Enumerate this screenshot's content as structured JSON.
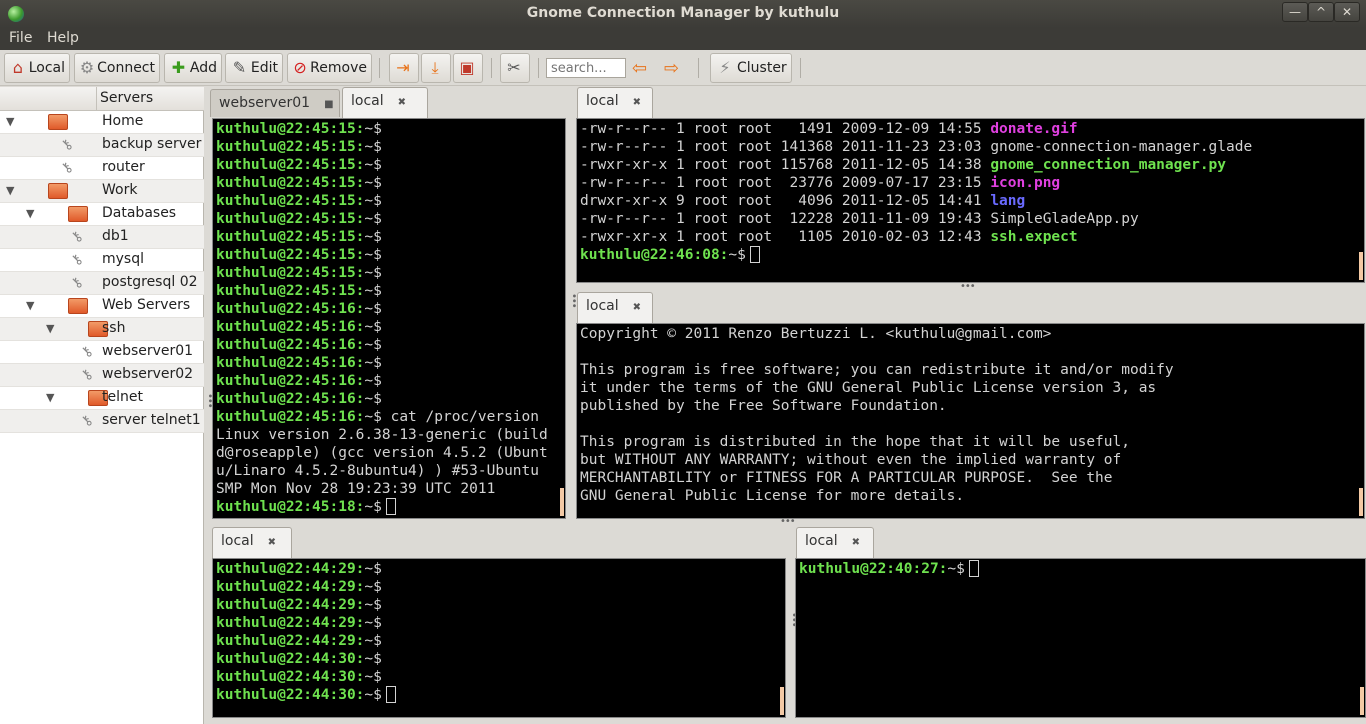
{
  "window": {
    "title": "Gnome Connection Manager by kuthulu"
  },
  "window_controls": {
    "minimize": "—",
    "maximize": "^",
    "close": "✕"
  },
  "menu": {
    "file": "File",
    "help": "Help"
  },
  "toolbar": {
    "local": "Local",
    "connect": "Connect",
    "add": "Add",
    "edit": "Edit",
    "remove": "Remove",
    "search_placeholder": "search...",
    "cluster": "Cluster"
  },
  "sidebar": {
    "header": "Servers",
    "items": [
      {
        "label": "Home",
        "type": "folder",
        "level": 0,
        "expanded": true
      },
      {
        "label": "backup server",
        "type": "host",
        "level": 1
      },
      {
        "label": "router",
        "type": "host",
        "level": 1
      },
      {
        "label": "Work",
        "type": "folder",
        "level": 0,
        "expanded": true
      },
      {
        "label": "Databases",
        "type": "folder",
        "level": 1,
        "expanded": true
      },
      {
        "label": "db1",
        "type": "host",
        "level": 2
      },
      {
        "label": "mysql",
        "type": "host",
        "level": 2
      },
      {
        "label": "postgresql 02",
        "type": "host",
        "level": 2
      },
      {
        "label": "Web Servers",
        "type": "folder",
        "level": 1,
        "expanded": true
      },
      {
        "label": "ssh",
        "type": "folder",
        "level": 2,
        "expanded": true
      },
      {
        "label": "webserver01",
        "type": "host",
        "level": 3
      },
      {
        "label": "webserver02",
        "type": "host",
        "level": 3
      },
      {
        "label": "telnet",
        "type": "folder",
        "level": 2,
        "expanded": true
      },
      {
        "label": "server telnet1",
        "type": "host",
        "level": 3
      }
    ]
  },
  "panel_top_left": {
    "tabs": [
      {
        "label": "webserver01",
        "active": false
      },
      {
        "label": "local",
        "active": true
      }
    ],
    "lines": [
      {
        "prompt": "kuthulu@22:45:15:",
        "rest": "~$"
      },
      {
        "prompt": "kuthulu@22:45:15:",
        "rest": "~$"
      },
      {
        "prompt": "kuthulu@22:45:15:",
        "rest": "~$"
      },
      {
        "prompt": "kuthulu@22:45:15:",
        "rest": "~$"
      },
      {
        "prompt": "kuthulu@22:45:15:",
        "rest": "~$"
      },
      {
        "prompt": "kuthulu@22:45:15:",
        "rest": "~$"
      },
      {
        "prompt": "kuthulu@22:45:15:",
        "rest": "~$"
      },
      {
        "prompt": "kuthulu@22:45:15:",
        "rest": "~$"
      },
      {
        "prompt": "kuthulu@22:45:15:",
        "rest": "~$"
      },
      {
        "prompt": "kuthulu@22:45:15:",
        "rest": "~$"
      },
      {
        "prompt": "kuthulu@22:45:16:",
        "rest": "~$"
      },
      {
        "prompt": "kuthulu@22:45:16:",
        "rest": "~$"
      },
      {
        "prompt": "kuthulu@22:45:16:",
        "rest": "~$"
      },
      {
        "prompt": "kuthulu@22:45:16:",
        "rest": "~$"
      },
      {
        "prompt": "kuthulu@22:45:16:",
        "rest": "~$"
      },
      {
        "prompt": "kuthulu@22:45:16:",
        "rest": "~$"
      },
      {
        "prompt": "kuthulu@22:45:16:",
        "rest": "~$ cat /proc/version"
      },
      {
        "prompt": "",
        "rest": "Linux version 2.6.38-13-generic (build"
      },
      {
        "prompt": "",
        "rest": "d@roseapple) (gcc version 4.5.2 (Ubunt"
      },
      {
        "prompt": "",
        "rest": "u/Linaro 4.5.2-8ubuntu4) ) #53-Ubuntu"
      },
      {
        "prompt": "",
        "rest": "SMP Mon Nov 28 19:23:39 UTC 2011"
      },
      {
        "prompt": "kuthulu@22:45:18:",
        "rest": "~$",
        "cursor": true
      }
    ]
  },
  "panel_top_right": {
    "tabs": [
      {
        "label": "local",
        "active": true
      }
    ],
    "lines": [
      {
        "meta": "-rw-r--r-- 1 root root   1491 2009-12-09 14:55 ",
        "name": "donate.gif",
        "style": "d1"
      },
      {
        "meta": "-rw-r--r-- 1 root root 141368 2011-11-23 23:03 ",
        "name": "gnome-connection-manager.glade",
        "style": "c"
      },
      {
        "meta": "-rwxr-xr-x 1 root root 115768 2011-12-05 14:38 ",
        "name": "gnome_connection_manager.py",
        "style": "d2"
      },
      {
        "meta": "-rw-r--r-- 1 root root  23776 2009-07-17 23:15 ",
        "name": "icon.png",
        "style": "d1"
      },
      {
        "meta": "drwxr-xr-x 9 root root   4096 2011-12-05 14:41 ",
        "name": "lang",
        "style": "d3"
      },
      {
        "meta": "-rw-r--r-- 1 root root  12228 2011-11-09 19:43 ",
        "name": "SimpleGladeApp.py",
        "style": "c"
      },
      {
        "meta": "-rwxr-xr-x 1 root root   1105 2010-02-03 12:43 ",
        "name": "ssh.expect",
        "style": "d2"
      }
    ],
    "prompt": "kuthulu@22:46:08:",
    "prompt_rest": "~$"
  },
  "panel_mid_right": {
    "tabs": [
      {
        "label": "local",
        "active": true
      }
    ],
    "lines": [
      "Copyright © 2011 Renzo Bertuzzi L. <kuthulu@gmail.com>",
      "",
      "This program is free software; you can redistribute it and/or modify",
      "it under the terms of the GNU General Public License version 3, as",
      "published by the Free Software Foundation.",
      "",
      "This program is distributed in the hope that it will be useful,",
      "but WITHOUT ANY WARRANTY; without even the implied warranty of",
      "MERCHANTABILITY or FITNESS FOR A PARTICULAR PURPOSE.  See the",
      "GNU General Public License for more details."
    ]
  },
  "panel_bottom_left": {
    "tabs": [
      {
        "label": "local",
        "active": true
      }
    ],
    "lines": [
      {
        "prompt": "kuthulu@22:44:29:",
        "rest": "~$"
      },
      {
        "prompt": "kuthulu@22:44:29:",
        "rest": "~$"
      },
      {
        "prompt": "kuthulu@22:44:29:",
        "rest": "~$"
      },
      {
        "prompt": "kuthulu@22:44:29:",
        "rest": "~$"
      },
      {
        "prompt": "kuthulu@22:44:29:",
        "rest": "~$"
      },
      {
        "prompt": "kuthulu@22:44:30:",
        "rest": "~$"
      },
      {
        "prompt": "kuthulu@22:44:30:",
        "rest": "~$"
      },
      {
        "prompt": "kuthulu@22:44:30:",
        "rest": "~$",
        "cursor": true
      }
    ]
  },
  "panel_bottom_right": {
    "tabs": [
      {
        "label": "local",
        "active": true
      }
    ],
    "lines": [
      {
        "prompt": "kuthulu@22:40:27:",
        "rest": "~$",
        "cursor": true
      }
    ]
  }
}
